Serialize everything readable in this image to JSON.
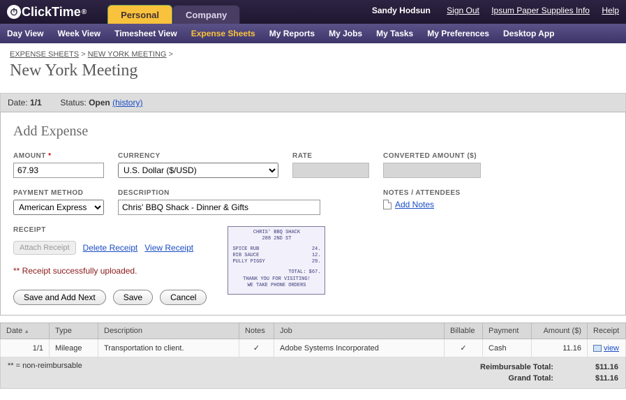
{
  "brand": "ClickTime",
  "top_tabs": {
    "personal": "Personal",
    "company": "Company"
  },
  "user": {
    "name": "Sandy Hodsun",
    "sign_out": "Sign Out",
    "supplies": "Ipsum Paper Supplies Info",
    "help": "Help"
  },
  "nav": {
    "day": "Day View",
    "week": "Week View",
    "timesheet": "Timesheet View",
    "expense": "Expense Sheets",
    "reports": "My Reports",
    "jobs": "My Jobs",
    "tasks": "My Tasks",
    "prefs": "My Preferences",
    "desktop": "Desktop App"
  },
  "breadcrumb": {
    "root": "EXPENSE SHEETS",
    "current": "NEW YORK MEETING",
    "sep": ">"
  },
  "page_title": "New York Meeting",
  "status": {
    "date_label": "Date:",
    "date": "1/1",
    "status_label": "Status:",
    "status": "Open",
    "history": "(history)"
  },
  "form": {
    "title": "Add Expense",
    "labels": {
      "amount": "AMOUNT",
      "currency": "CURRENCY",
      "rate": "RATE",
      "converted": "CONVERTED AMOUNT ($)",
      "payment": "PAYMENT METHOD",
      "description": "DESCRIPTION",
      "notes": "NOTES / ATTENDEES",
      "receipt": "RECEIPT"
    },
    "amount": "67.93",
    "currency": "U.S. Dollar ($/USD)",
    "payment": "American Express",
    "description": "Chris' BBQ Shack - Dinner & Gifts",
    "add_notes": "Add Notes",
    "attach": "Attach Receipt",
    "delete_receipt": "Delete Receipt",
    "view_receipt": "View Receipt",
    "status_msg": "** Receipt successfully uploaded.",
    "buttons": {
      "savenext": "Save and Add Next",
      "save": "Save",
      "cancel": "Cancel"
    }
  },
  "receipt_preview": {
    "l1": "CHRIS' BBQ SHACK",
    "l2": "288 2ND ST",
    "items": [
      {
        "name": "SPICE RUB",
        "price": "24."
      },
      {
        "name": "RIB SAUCE",
        "price": "12."
      },
      {
        "name": "PULLY PIGGY",
        "price": "29."
      }
    ],
    "total": "TOTAL: $67.",
    "f1": "THANK YOU FOR VISITING!",
    "f2": "WE TAKE PHONE ORDERS"
  },
  "grid": {
    "headers": {
      "date": "Date",
      "type": "Type",
      "desc": "Description",
      "notes": "Notes",
      "job": "Job",
      "billable": "Billable",
      "payment": "Payment",
      "amount": "Amount ($)",
      "receipt": "Receipt"
    },
    "rows": [
      {
        "date": "1/1",
        "type": "Mileage",
        "desc": "Transportation to client.",
        "notes": "✓",
        "job": "Adobe Systems Incorporated",
        "billable": "✓",
        "payment": "Cash",
        "amount": "11.16",
        "receipt": "view"
      }
    ]
  },
  "footer": {
    "legend": "** = non-reimbursable",
    "reimbursable_label": "Reimbursable Total:",
    "reimbursable": "$11.16",
    "grand_label": "Grand Total:",
    "grand": "$11.16"
  }
}
